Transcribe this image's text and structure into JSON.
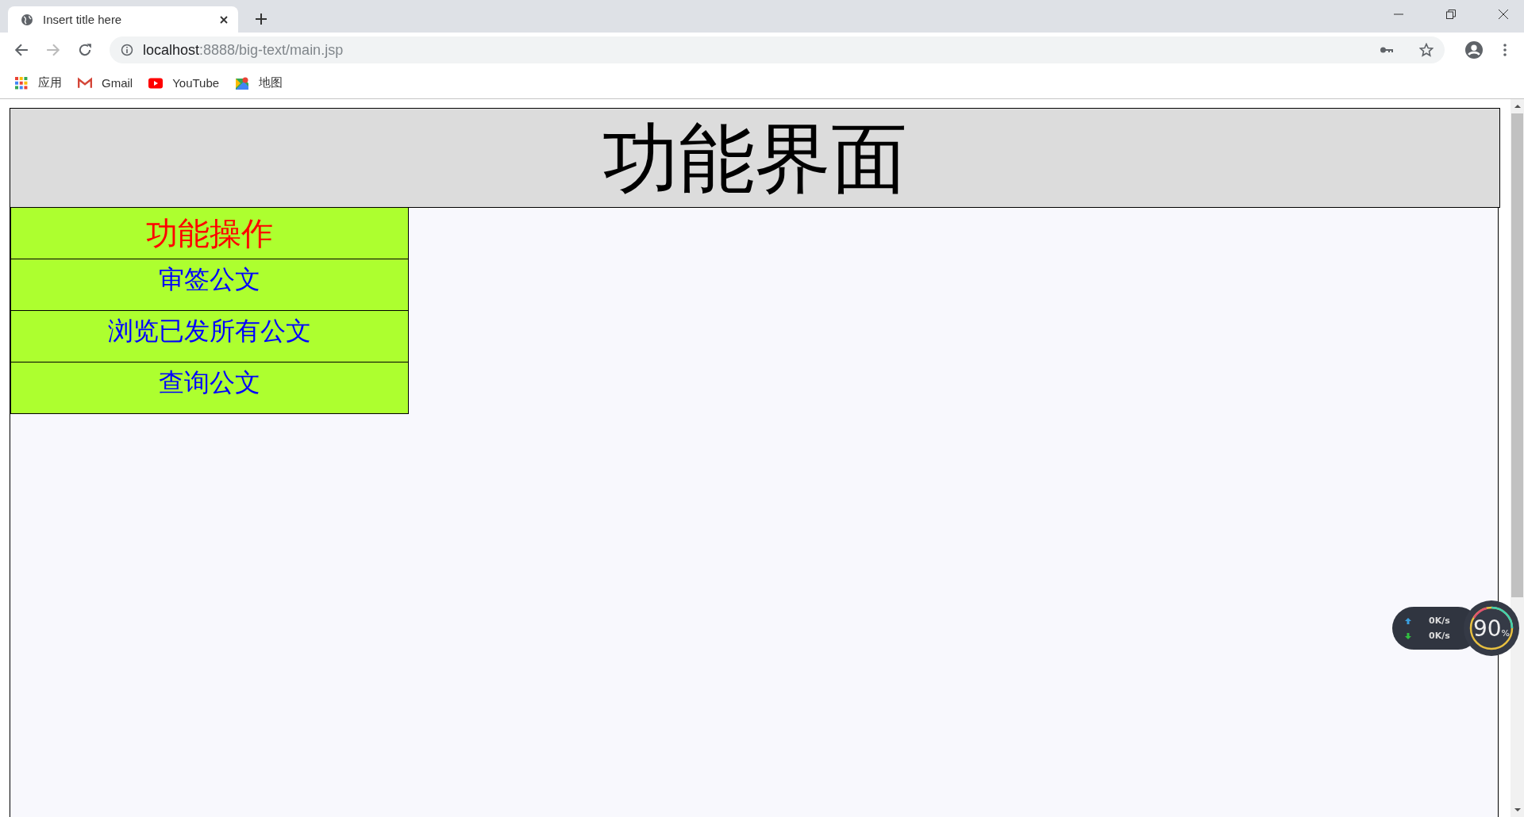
{
  "browser": {
    "tab": {
      "title": "Insert title here"
    },
    "url": {
      "host": "localhost",
      "path": ":8888/big-text/main.jsp"
    },
    "bookmarks": [
      {
        "kind": "apps",
        "label": "应用"
      },
      {
        "kind": "gmail",
        "label": "Gmail"
      },
      {
        "kind": "youtube",
        "label": "YouTube"
      },
      {
        "kind": "maps",
        "label": "地图"
      }
    ]
  },
  "page": {
    "header": "功能界面",
    "menu": {
      "heading": "功能操作",
      "items": [
        "审签公文",
        "浏览已发所有公文",
        "查询公文"
      ]
    }
  },
  "speed_widget": {
    "upload": "0K/s",
    "download": "0K/s",
    "percent": "90",
    "unit": "%"
  }
}
